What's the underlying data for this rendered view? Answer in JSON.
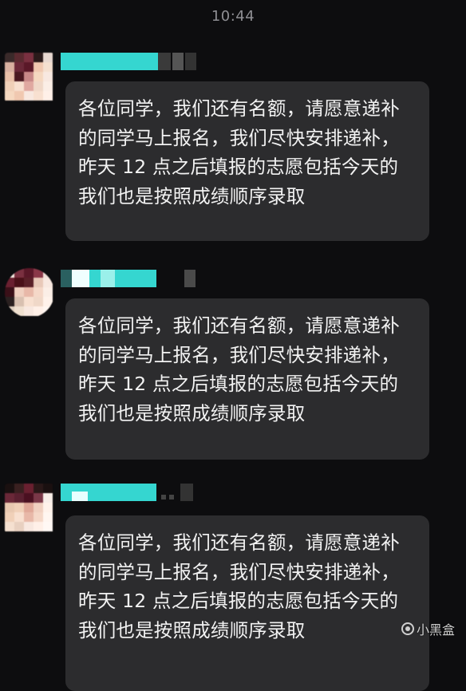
{
  "status_time": "10:44",
  "messages": [
    {
      "text": "各位同学，我们还有名额，请愿意递补的同学马上报名，我们尽快安排递补，昨天 12 点之后填报的志愿包括今天的 我们也是按照成绩顺序录取"
    },
    {
      "text": "各位同学，我们还有名额，请愿意递补的同学马上报名，我们尽快安排递补，昨天 12 点之后填报的志愿包括今天的 我们也是按照成绩顺序录取"
    },
    {
      "text": "各位同学，我们还有名额，请愿意递补的同学马上报名，我们尽快安排递补，昨天 12 点之后填报的志愿包括今天的 我们也是按照成绩顺序录取"
    }
  ],
  "watermark": "小黑盒",
  "colors": {
    "background": "#0d0d0f",
    "bubble": "#2c2c2e",
    "censor_cyan": "#35d6d0"
  }
}
